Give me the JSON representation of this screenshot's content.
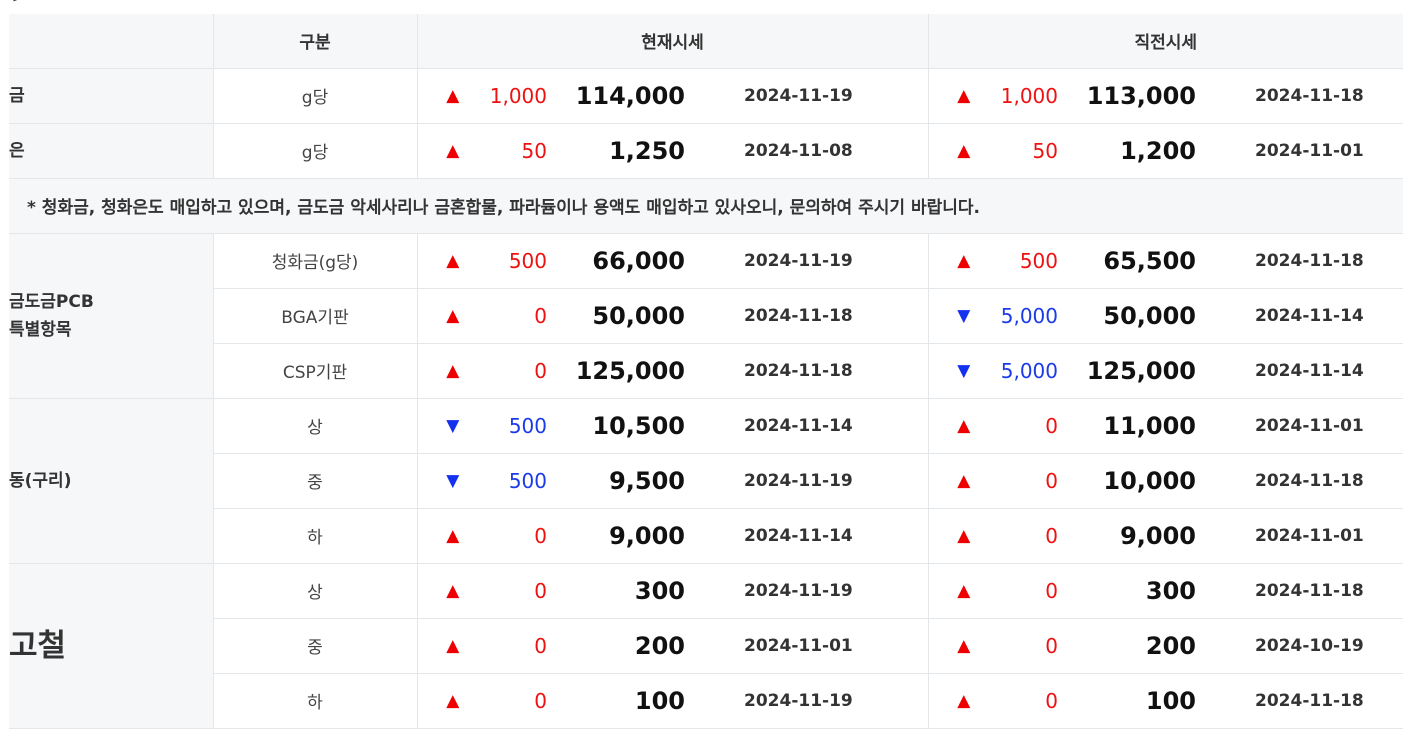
{
  "header": {
    "category": "",
    "type": "구분",
    "current": "현재시세",
    "previous": "직전시세"
  },
  "notice": "* 청화금, 청화은도 매입하고 있으며, 금도금 악세사리나 금혼합물, 파라듐이나 용액도 매입하고 있사오니, 문의하여 주시기 바랍니다.",
  "groups": [
    {
      "category": "금",
      "rows": [
        {
          "sub": "g당",
          "cur": {
            "dir": "up",
            "arrow": "▲",
            "change": "1,000",
            "price": "114,000",
            "date": "2024-11-19"
          },
          "prev": {
            "dir": "up",
            "arrow": "▲",
            "change": "1,000",
            "price": "113,000",
            "date": "2024-11-18"
          }
        }
      ]
    },
    {
      "category": "은",
      "rows": [
        {
          "sub": "g당",
          "cur": {
            "dir": "up",
            "arrow": "▲",
            "change": "50",
            "price": "1,250",
            "date": "2024-11-08"
          },
          "prev": {
            "dir": "up",
            "arrow": "▲",
            "change": "50",
            "price": "1,200",
            "date": "2024-11-01"
          }
        }
      ]
    },
    {
      "category": "금도금PCB\n특별항목",
      "rows": [
        {
          "sub": "청화금(g당)",
          "cur": {
            "dir": "up",
            "arrow": "▲",
            "change": "500",
            "price": "66,000",
            "date": "2024-11-19"
          },
          "prev": {
            "dir": "up",
            "arrow": "▲",
            "change": "500",
            "price": "65,500",
            "date": "2024-11-18"
          }
        },
        {
          "sub": "BGA기판",
          "cur": {
            "dir": "up",
            "arrow": "▲",
            "change": "0",
            "price": "50,000",
            "date": "2024-11-18"
          },
          "prev": {
            "dir": "down",
            "arrow": "▼",
            "change": "5,000",
            "price": "50,000",
            "date": "2024-11-14"
          }
        },
        {
          "sub": "CSP기판",
          "cur": {
            "dir": "up",
            "arrow": "▲",
            "change": "0",
            "price": "125,000",
            "date": "2024-11-18"
          },
          "prev": {
            "dir": "down",
            "arrow": "▼",
            "change": "5,000",
            "price": "125,000",
            "date": "2024-11-14"
          }
        }
      ]
    },
    {
      "category": "동(구리)",
      "rows": [
        {
          "sub": "상",
          "cur": {
            "dir": "down",
            "arrow": "▼",
            "change": "500",
            "price": "10,500",
            "date": "2024-11-14"
          },
          "prev": {
            "dir": "up",
            "arrow": "▲",
            "change": "0",
            "price": "11,000",
            "date": "2024-11-01"
          }
        },
        {
          "sub": "중",
          "cur": {
            "dir": "down",
            "arrow": "▼",
            "change": "500",
            "price": "9,500",
            "date": "2024-11-19"
          },
          "prev": {
            "dir": "up",
            "arrow": "▲",
            "change": "0",
            "price": "10,000",
            "date": "2024-11-18"
          }
        },
        {
          "sub": "하",
          "cur": {
            "dir": "up",
            "arrow": "▲",
            "change": "0",
            "price": "9,000",
            "date": "2024-11-14"
          },
          "prev": {
            "dir": "up",
            "arrow": "▲",
            "change": "0",
            "price": "9,000",
            "date": "2024-11-01"
          }
        }
      ]
    },
    {
      "category": "고철",
      "big": true,
      "rows": [
        {
          "sub": "상",
          "cur": {
            "dir": "up",
            "arrow": "▲",
            "change": "0",
            "price": "300",
            "date": "2024-11-19"
          },
          "prev": {
            "dir": "up",
            "arrow": "▲",
            "change": "0",
            "price": "300",
            "date": "2024-11-18"
          }
        },
        {
          "sub": "중",
          "cur": {
            "dir": "up",
            "arrow": "▲",
            "change": "0",
            "price": "200",
            "date": "2024-11-01"
          },
          "prev": {
            "dir": "up",
            "arrow": "▲",
            "change": "0",
            "price": "200",
            "date": "2024-10-19"
          }
        },
        {
          "sub": "하",
          "cur": {
            "dir": "up",
            "arrow": "▲",
            "change": "0",
            "price": "100",
            "date": "2024-11-19"
          },
          "prev": {
            "dir": "up",
            "arrow": "▲",
            "change": "0",
            "price": "100",
            "date": "2024-11-18"
          }
        }
      ]
    }
  ],
  "colors": {
    "up": "#ee0000",
    "down": "#1431f0",
    "header_bg": "#f5f7f8"
  }
}
